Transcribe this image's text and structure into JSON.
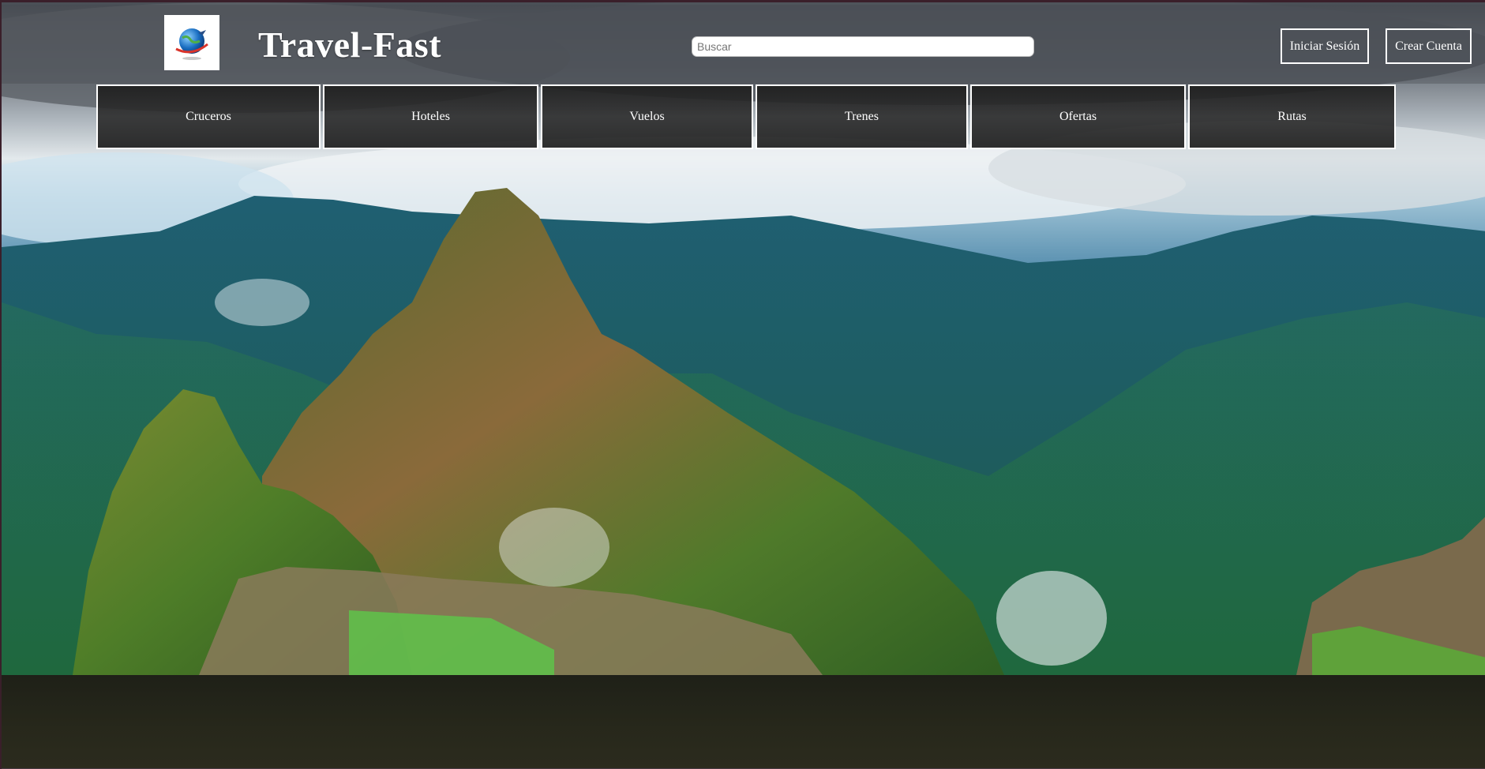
{
  "brand": {
    "name": "Travel-Fast",
    "logo_icon": "globe-airplane-icon"
  },
  "search": {
    "placeholder": "Buscar",
    "value": ""
  },
  "auth": {
    "login_label": "Iniciar Sesión",
    "signup_label": "Crear Cuenta"
  },
  "nav": {
    "items": [
      {
        "label": "Cruceros"
      },
      {
        "label": "Hoteles"
      },
      {
        "label": "Vuelos"
      },
      {
        "label": "Trenes"
      },
      {
        "label": "Ofertas"
      },
      {
        "label": "Rutas"
      }
    ]
  },
  "hero": {
    "image": "machu-picchu-landscape"
  },
  "colors": {
    "nav_bg": "#2a2a2a",
    "border": "#ffffff",
    "text": "#ffffff"
  }
}
